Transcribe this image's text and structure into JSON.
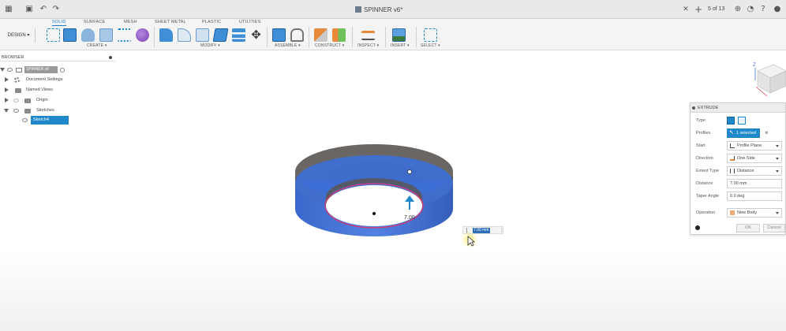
{
  "window": {
    "document_title": "SPINNER v6*",
    "tab_counter": "5 of 13"
  },
  "workspace_tabs": [
    "SOLID",
    "SURFACE",
    "MESH",
    "SHEET METAL",
    "PLASTIC",
    "UTILITIES"
  ],
  "active_workspace_tab": "SOLID",
  "design_button": "DESIGN ▾",
  "tool_groups": [
    {
      "label": "CREATE ▾"
    },
    {
      "label": "MODIFY ▾"
    },
    {
      "label": "ASSEMBLE ▾"
    },
    {
      "label": "CONSTRUCT ▾"
    },
    {
      "label": "INSPECT ▾"
    },
    {
      "label": "INSERT ▾"
    },
    {
      "label": "SELECT ▾"
    }
  ],
  "browser": {
    "title": "BROWSER",
    "items": [
      {
        "label": "SPINNER v6"
      },
      {
        "label": "Document Settings"
      },
      {
        "label": "Named Views"
      },
      {
        "label": "Origin"
      },
      {
        "label": "Sketches"
      },
      {
        "label": "Sketch4"
      }
    ]
  },
  "viewport": {
    "dimension_text": "7.00",
    "distance_input": "7.00 mm"
  },
  "extrude": {
    "title": "EXTRUDE",
    "rows": {
      "type_label": "Type",
      "profiles_label": "Profiles",
      "profiles_value": "1 selected",
      "start_label": "Start",
      "start_value": "Profile Plane",
      "direction_label": "Direction",
      "direction_value": "One Side",
      "extent_label": "Extent Type",
      "extent_value": "Distance",
      "distance_label": "Distance",
      "distance_value": "7.00 mm",
      "taper_label": "Taper Angle",
      "taper_value": "0.0 deg",
      "operation_label": "Operation",
      "operation_value": "New Body"
    },
    "ok_label": "OK",
    "cancel_label": "Cancel"
  },
  "colors": {
    "accent": "#1e88c9",
    "body_blue": "#2f5fc8",
    "body_grey": "#6e6a68",
    "profile_red": "#e0336a"
  }
}
